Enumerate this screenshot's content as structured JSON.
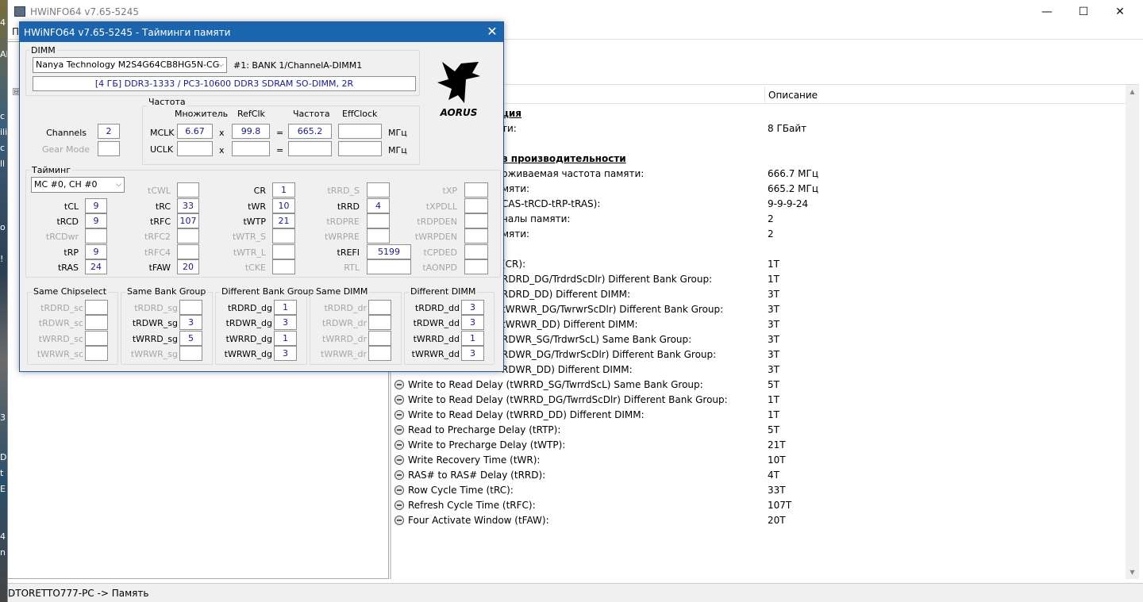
{
  "desktop_edge_text": [
    "4",
    "Al",
    "c",
    "ili",
    "c",
    "ll",
    "o",
    "!",
    "3",
    "D",
    "t",
    "E",
    "4",
    "n"
  ],
  "main_window": {
    "title": "HWiNFO64 v7.65-5245",
    "menu_first": "П",
    "tree_expander": "⊟",
    "column_description": "Описание",
    "rows": [
      {
        "label": "ция",
        "value": "",
        "section": true
      },
      {
        "label": "ти:",
        "value": "8 ГБайт",
        "section": false
      },
      {
        "label": "в производительности",
        "value": "",
        "section": true
      },
      {
        "label": "рживаемая частота памяти:",
        "value": "666.7 МГц",
        "section": false
      },
      {
        "label": "мяти:",
        "value": "665.2 МГц",
        "section": false
      },
      {
        "label": "CAS-tRCD-tRP-tRAS):",
        "value": "9-9-9-24",
        "section": false
      },
      {
        "label": "налы памяти:",
        "value": "2",
        "section": false
      },
      {
        "label": "мяти:",
        "value": "2",
        "section": false
      },
      {
        "label": "(CR):",
        "value": "1T",
        "section": false
      },
      {
        "label": "RDRD_DG/TrdrdScDlr) Different Bank Group:",
        "value": "1T",
        "section": false
      },
      {
        "label": "RDRD_DD) Different DIMM:",
        "value": "3T",
        "section": false
      },
      {
        "label": "tWRWR_DG/TwrwrScDlr) Different Bank Group:",
        "value": "3T",
        "section": false
      },
      {
        "label": "tWRWR_DD) Different DIMM:",
        "value": "3T",
        "section": false
      },
      {
        "label": "RDWR_SG/TrdwrScL) Same Bank Group:",
        "value": "3T",
        "section": false
      },
      {
        "label": "RDWR_DG/TrdwrScDlr) Different Bank Group:",
        "value": "3T",
        "section": false
      },
      {
        "label": "RDWR_DD) Different DIMM:",
        "value": "3T",
        "section": false
      },
      {
        "label": "Write to Read Delay (tWRRD_SG/TwrrdScL) Same Bank Group:",
        "value": "5T",
        "section": false
      },
      {
        "label": "Write to Read Delay (tWRRD_DG/TwrrdScDlr) Different Bank Group:",
        "value": "1T",
        "section": false
      },
      {
        "label": "Write to Read Delay (tWRRD_DD) Different DIMM:",
        "value": "1T",
        "section": false
      },
      {
        "label": "Read to Precharge Delay (tRTP):",
        "value": "5T",
        "section": false
      },
      {
        "label": "Write to Precharge Delay (tWTP):",
        "value": "21T",
        "section": false
      },
      {
        "label": "Write Recovery Time (tWR):",
        "value": "10T",
        "section": false
      },
      {
        "label": "RAS# to RAS# Delay (tRRD):",
        "value": "4T",
        "section": false
      },
      {
        "label": "Row Cycle Time (tRC):",
        "value": "33T",
        "section": false
      },
      {
        "label": "Refresh Cycle Time (tRFC):",
        "value": "107T",
        "section": false
      },
      {
        "label": "Four Activate Window (tFAW):",
        "value": "20T",
        "section": false
      }
    ],
    "status": "DTORETTO777-PC -> Память"
  },
  "dialog": {
    "title": "HWiNFO64 v7.65-5245 - Тайминги памяти",
    "close": "✕",
    "dimm_label": "DIMM",
    "dimm_select": "Nanya Technology M2S4G64CB8HG5N-CG",
    "dimm_slot": "#1: BANK 1/ChannelA-DIMM1",
    "dimm_info": "[4 ГБ] DDR3-1333 / PC3-10600 DDR3 SDRAM SO-DIMM, 2R",
    "freq": {
      "group": "Частота",
      "h_mult": "Множитель",
      "h_refclk": "RefClk",
      "h_freq": "Частота",
      "h_eff": "EffClock",
      "mclk": "MCLK",
      "uclk": "UCLK",
      "mclk_mult": "6.67",
      "mclk_ref": "99.8",
      "mclk_freq": "665.2",
      "x": "x",
      "eq": "=",
      "unit": "МГц"
    },
    "channels_label": "Channels",
    "channels": "2",
    "gear_label": "Gear Mode",
    "timing_label": "Тайминг",
    "mc_select": "MC #0, CH #0",
    "col1": [
      {
        "n": "tCL",
        "v": "9",
        "d": false
      },
      {
        "n": "tRCD",
        "v": "9",
        "d": false
      },
      {
        "n": "tRCDwr",
        "v": "",
        "d": true
      },
      {
        "n": "tRP",
        "v": "9",
        "d": false
      },
      {
        "n": "tRAS",
        "v": "24",
        "d": false
      }
    ],
    "col2": [
      {
        "n": "tCWL",
        "v": "",
        "d": true
      },
      {
        "n": "tRC",
        "v": "33",
        "d": false
      },
      {
        "n": "tRFC",
        "v": "107",
        "d": false
      },
      {
        "n": "tRFC2",
        "v": "",
        "d": true
      },
      {
        "n": "tRFC4",
        "v": "",
        "d": true
      },
      {
        "n": "tFAW",
        "v": "20",
        "d": false
      }
    ],
    "col3": [
      {
        "n": "CR",
        "v": "1",
        "d": false
      },
      {
        "n": "tWR",
        "v": "10",
        "d": false
      },
      {
        "n": "tWTP",
        "v": "21",
        "d": false
      },
      {
        "n": "tWTR_S",
        "v": "",
        "d": true
      },
      {
        "n": "tWTR_L",
        "v": "",
        "d": true
      },
      {
        "n": "tCKE",
        "v": "",
        "d": true
      }
    ],
    "col4": [
      {
        "n": "tRRD_S",
        "v": "",
        "d": true
      },
      {
        "n": "tRRD",
        "v": "4",
        "d": false
      },
      {
        "n": "tRDPRE",
        "v": "",
        "d": true
      },
      {
        "n": "tWRPRE",
        "v": "",
        "d": true
      },
      {
        "n": "tREFI",
        "v": "5199",
        "d": false
      },
      {
        "n": "RTL",
        "v": "",
        "d": true
      }
    ],
    "col5": [
      {
        "n": "tXP",
        "v": "",
        "d": true
      },
      {
        "n": "tXPDLL",
        "v": "",
        "d": true
      },
      {
        "n": "tRDPDEN",
        "v": "",
        "d": true
      },
      {
        "n": "tWRPDEN",
        "v": "",
        "d": true
      },
      {
        "n": "tCPDED",
        "v": "",
        "d": true
      },
      {
        "n": "tAONPD",
        "v": "",
        "d": true
      }
    ],
    "groups": [
      {
        "title": "Same Chipselect",
        "rows": [
          {
            "n": "tRDRD_sc",
            "v": "",
            "d": true
          },
          {
            "n": "tRDWR_sc",
            "v": "",
            "d": true
          },
          {
            "n": "tWRRD_sc",
            "v": "",
            "d": true
          },
          {
            "n": "tWRWR_sc",
            "v": "",
            "d": true
          }
        ]
      },
      {
        "title": "Same Bank Group",
        "rows": [
          {
            "n": "tRDRD_sg",
            "v": "",
            "d": true
          },
          {
            "n": "tRDWR_sg",
            "v": "3",
            "d": false
          },
          {
            "n": "tWRRD_sg",
            "v": "5",
            "d": false
          },
          {
            "n": "tWRWR_sg",
            "v": "",
            "d": true
          }
        ]
      },
      {
        "title": "Different Bank Group",
        "rows": [
          {
            "n": "tRDRD_dg",
            "v": "1",
            "d": false
          },
          {
            "n": "tRDWR_dg",
            "v": "3",
            "d": false
          },
          {
            "n": "tWRRD_dg",
            "v": "1",
            "d": false
          },
          {
            "n": "tWRWR_dg",
            "v": "3",
            "d": false
          }
        ]
      },
      {
        "title": "Same DIMM",
        "rows": [
          {
            "n": "tRDRD_dr",
            "v": "",
            "d": true
          },
          {
            "n": "tRDWR_dr",
            "v": "",
            "d": true
          },
          {
            "n": "tWRRD_dr",
            "v": "",
            "d": true
          },
          {
            "n": "tWRWR_dr",
            "v": "",
            "d": true
          }
        ]
      },
      {
        "title": "Different DIMM",
        "rows": [
          {
            "n": "tRDRD_dd",
            "v": "3",
            "d": false
          },
          {
            "n": "tRDWR_dd",
            "v": "3",
            "d": false
          },
          {
            "n": "tWRRD_dd",
            "v": "1",
            "d": false
          },
          {
            "n": "tWRWR_dd",
            "v": "3",
            "d": false
          }
        ]
      }
    ],
    "logo_text": "AORUS"
  },
  "colors": {
    "title_bar": "#1a65ad",
    "value_text": "#1a1a8c",
    "disabled": "#a6a6a6"
  }
}
